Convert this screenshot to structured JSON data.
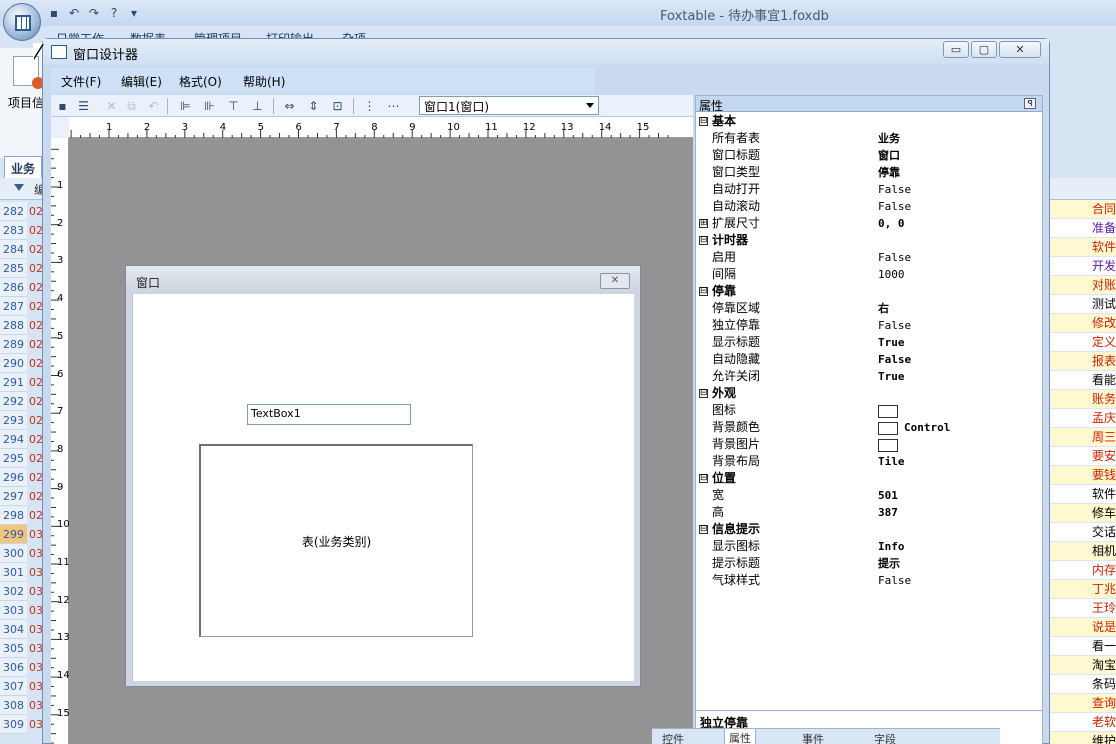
{
  "app": {
    "title": "Foxtable - 待办事宜1.foxdb",
    "tabs": [
      "日常工作",
      "数据表",
      "管理项目",
      "打印输出",
      "杂项"
    ],
    "ribbon_button": "项目信",
    "table_tab": "业务",
    "column_header_label": "编"
  },
  "left_rows": [
    {
      "n": "282",
      "v": "02",
      "hl": false
    },
    {
      "n": "283",
      "v": "02",
      "hl": false
    },
    {
      "n": "284",
      "v": "02",
      "hl": false
    },
    {
      "n": "285",
      "v": "02",
      "hl": false
    },
    {
      "n": "286",
      "v": "02",
      "hl": false
    },
    {
      "n": "287",
      "v": "02",
      "hl": false
    },
    {
      "n": "288",
      "v": "02",
      "hl": false
    },
    {
      "n": "289",
      "v": "02",
      "hl": false
    },
    {
      "n": "290",
      "v": "02",
      "hl": false
    },
    {
      "n": "291",
      "v": "02",
      "hl": false
    },
    {
      "n": "292",
      "v": "02",
      "hl": false
    },
    {
      "n": "293",
      "v": "02",
      "hl": false
    },
    {
      "n": "294",
      "v": "02",
      "hl": false
    },
    {
      "n": "295",
      "v": "02",
      "hl": false
    },
    {
      "n": "296",
      "v": "02",
      "hl": false
    },
    {
      "n": "297",
      "v": "02",
      "hl": false
    },
    {
      "n": "298",
      "v": "02",
      "hl": false
    },
    {
      "n": "299",
      "v": "03",
      "hl": true
    },
    {
      "n": "300",
      "v": "03",
      "hl": false
    },
    {
      "n": "301",
      "v": "03",
      "hl": false
    },
    {
      "n": "302",
      "v": "03",
      "hl": false
    },
    {
      "n": "303",
      "v": "03",
      "hl": false
    },
    {
      "n": "304",
      "v": "03",
      "hl": false
    },
    {
      "n": "305",
      "v": "03",
      "hl": false
    },
    {
      "n": "306",
      "v": "03",
      "hl": false
    },
    {
      "n": "307",
      "v": "03",
      "hl": false
    },
    {
      "n": "308",
      "v": "03",
      "hl": false
    },
    {
      "n": "309",
      "v": "03",
      "hl": false
    }
  ],
  "right_cells": [
    {
      "t": "合同",
      "c": "#cc2200",
      "bg": "#fff8d0"
    },
    {
      "t": "准备",
      "c": "#5a1aa8",
      "bg": "#ffffff"
    },
    {
      "t": "软件",
      "c": "#cc2200",
      "bg": "#fff8d0"
    },
    {
      "t": "开发",
      "c": "#5a1aa8",
      "bg": "#ffffff"
    },
    {
      "t": "对账",
      "c": "#cc2200",
      "bg": "#fff8d0"
    },
    {
      "t": "测试",
      "c": "#000000",
      "bg": "#ffffff"
    },
    {
      "t": "修改",
      "c": "#cc2200",
      "bg": "#fff8d0"
    },
    {
      "t": "定义",
      "c": "#cc2200",
      "bg": "#ffffff"
    },
    {
      "t": "报表",
      "c": "#cc2200",
      "bg": "#fff8d0"
    },
    {
      "t": "看能",
      "c": "#000000",
      "bg": "#ffffff"
    },
    {
      "t": "账务",
      "c": "#cc2200",
      "bg": "#fff8d0"
    },
    {
      "t": "孟庆",
      "c": "#cc2200",
      "bg": "#ffffff"
    },
    {
      "t": "周三",
      "c": "#cc2200",
      "bg": "#fff8d0"
    },
    {
      "t": "要安",
      "c": "#cc2200",
      "bg": "#ffffff"
    },
    {
      "t": "要钱",
      "c": "#cc2200",
      "bg": "#fff8d0"
    },
    {
      "t": "软件",
      "c": "#000000",
      "bg": "#ffffff"
    },
    {
      "t": "修车",
      "c": "#000000",
      "bg": "#fff8d0"
    },
    {
      "t": "交话",
      "c": "#000000",
      "bg": "#ffffff"
    },
    {
      "t": "相机",
      "c": "#000000",
      "bg": "#fff8d0"
    },
    {
      "t": "内存",
      "c": "#cc2200",
      "bg": "#ffffff"
    },
    {
      "t": "丁兆",
      "c": "#cc2200",
      "bg": "#fff8d0"
    },
    {
      "t": "王玲",
      "c": "#cc2200",
      "bg": "#ffffff"
    },
    {
      "t": "说是",
      "c": "#cc2200",
      "bg": "#fff8d0"
    },
    {
      "t": "看一",
      "c": "#000000",
      "bg": "#ffffff"
    },
    {
      "t": "淘宝",
      "c": "#000000",
      "bg": "#fff8d0"
    },
    {
      "t": "条码",
      "c": "#000000",
      "bg": "#ffffff"
    },
    {
      "t": "查询",
      "c": "#cc2200",
      "bg": "#fff8d0"
    },
    {
      "t": "老软",
      "c": "#cc2200",
      "bg": "#ffffff"
    },
    {
      "t": "维护",
      "c": "#000000",
      "bg": "#fff8d0"
    }
  ],
  "designer": {
    "title": "窗口设计器",
    "menus": [
      "文件(F)",
      "编辑(E)",
      "格式(O)",
      "帮助(H)"
    ],
    "window_buttons": {
      "minimize": "▭",
      "maximize": "▢",
      "close": "✕"
    },
    "combo_value": "窗口1(窗口)",
    "ruler_h": [
      "1",
      "2",
      "3",
      "4",
      "5",
      "6",
      "7",
      "8",
      "9",
      "10",
      "11",
      "12",
      "13",
      "14",
      "15"
    ],
    "ruler_v": [
      "1",
      "2",
      "3",
      "4",
      "5",
      "6",
      "7",
      "8",
      "9",
      "10",
      "11",
      "12",
      "13",
      "14",
      "15"
    ],
    "form_title": "窗口",
    "textbox_text": "TextBox1",
    "table_text": "表(业务类别)"
  },
  "properties": {
    "header": "属性",
    "pin": "ꟼ",
    "rows": [
      {
        "type": "cat",
        "name": "基本",
        "exp": "⊟"
      },
      {
        "type": "prop",
        "name": "所有者表",
        "value": "业务",
        "bold": true
      },
      {
        "type": "prop",
        "name": "窗口标题",
        "value": "窗口",
        "bold": true
      },
      {
        "type": "prop",
        "name": "窗口类型",
        "value": "停靠",
        "bold": true
      },
      {
        "type": "prop",
        "name": "自动打开",
        "value": "False",
        "bold": false
      },
      {
        "type": "prop",
        "name": "自动滚动",
        "value": "False",
        "bold": false
      },
      {
        "type": "sub",
        "name": "扩展尺寸",
        "value": "0, 0",
        "bold": true,
        "exp": "⊞"
      },
      {
        "type": "cat",
        "name": "计时器",
        "exp": "⊟"
      },
      {
        "type": "prop",
        "name": "启用",
        "value": "False",
        "bold": false
      },
      {
        "type": "prop",
        "name": "间隔",
        "value": "1000",
        "bold": false
      },
      {
        "type": "cat",
        "name": "停靠",
        "exp": "⊟"
      },
      {
        "type": "prop",
        "name": "停靠区域",
        "value": "右",
        "bold": true
      },
      {
        "type": "prop",
        "name": "独立停靠",
        "value": "False",
        "bold": false
      },
      {
        "type": "prop",
        "name": "显示标题",
        "value": "True",
        "bold": true
      },
      {
        "type": "prop",
        "name": "自动隐藏",
        "value": "False",
        "bold": true
      },
      {
        "type": "prop",
        "name": "允许关闭",
        "value": "True",
        "bold": true
      },
      {
        "type": "cat",
        "name": "外观",
        "exp": "⊟"
      },
      {
        "type": "swatch",
        "name": "图标",
        "value": ""
      },
      {
        "type": "swatch",
        "name": "背景颜色",
        "value": "Control"
      },
      {
        "type": "swatch",
        "name": "背景图片",
        "value": ""
      },
      {
        "type": "prop",
        "name": "背景布局",
        "value": "Tile",
        "bold": true
      },
      {
        "type": "cat",
        "name": "位置",
        "exp": "⊟"
      },
      {
        "type": "prop",
        "name": "宽",
        "value": "501",
        "bold": true
      },
      {
        "type": "prop",
        "name": "高",
        "value": "387",
        "bold": true
      },
      {
        "type": "cat",
        "name": "信息提示",
        "exp": "⊟"
      },
      {
        "type": "prop",
        "name": "显示图标",
        "value": "Info",
        "bold": true
      },
      {
        "type": "prop",
        "name": "提示标题",
        "value": "提示",
        "bold": true
      },
      {
        "type": "prop",
        "name": "气球样式",
        "value": "False",
        "bold": false
      }
    ],
    "description_title": "独立停靠",
    "bottom_tabs": [
      "控件",
      "属性",
      "事件",
      "字段"
    ]
  }
}
